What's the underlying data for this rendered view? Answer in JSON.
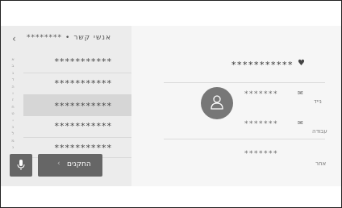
{
  "breadcrumb": {
    "title": "אנשי קשר",
    "masked_name": "********"
  },
  "index_letters": [
    "א",
    "ב",
    "ג",
    "ד",
    "ה",
    "ו",
    "ז",
    "ח",
    "ט",
    "י",
    "כ",
    "ל",
    "מ",
    "נ"
  ],
  "contacts": [
    "***********",
    "***********",
    "***********",
    "***********",
    "***********"
  ],
  "bottom": {
    "favorites_label": "החקנים",
    "mic_label": ""
  },
  "detail": {
    "name": "***********",
    "rows": [
      {
        "value": "*******",
        "label": "נייד"
      },
      {
        "value": "*******",
        "label": "עבודה"
      },
      {
        "value": "*******",
        "label": "אחר"
      }
    ]
  }
}
